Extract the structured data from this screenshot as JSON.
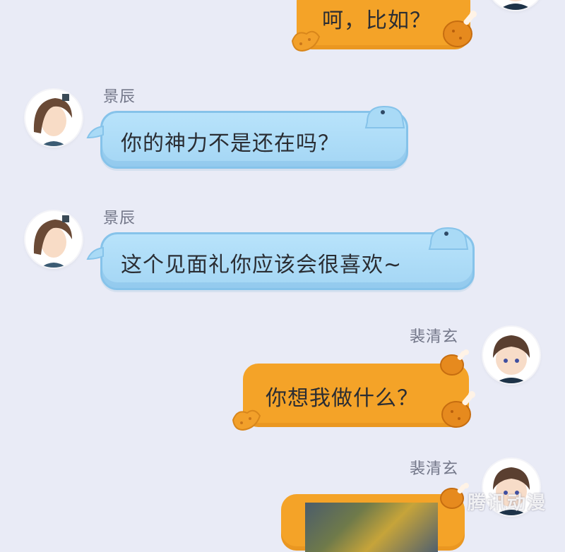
{
  "messages": [
    {
      "side": "right",
      "sender": "",
      "text": "呵，比如？"
    },
    {
      "side": "left",
      "sender": "景辰",
      "text": "你的神力不是还在吗？"
    },
    {
      "side": "left",
      "sender": "景辰",
      "text": "这个见面礼你应该会很喜欢~"
    },
    {
      "side": "right",
      "sender": "裴清玄",
      "text": "你想我做什么？"
    },
    {
      "side": "right",
      "sender": "裴清玄",
      "text": ""
    }
  ],
  "watermark": "腾讯动漫",
  "colors": {
    "background": "#e9ebf6",
    "blue_bubble": "#a4d6f4",
    "orange_bubble": "#f4a328",
    "name_text": "#737789"
  }
}
